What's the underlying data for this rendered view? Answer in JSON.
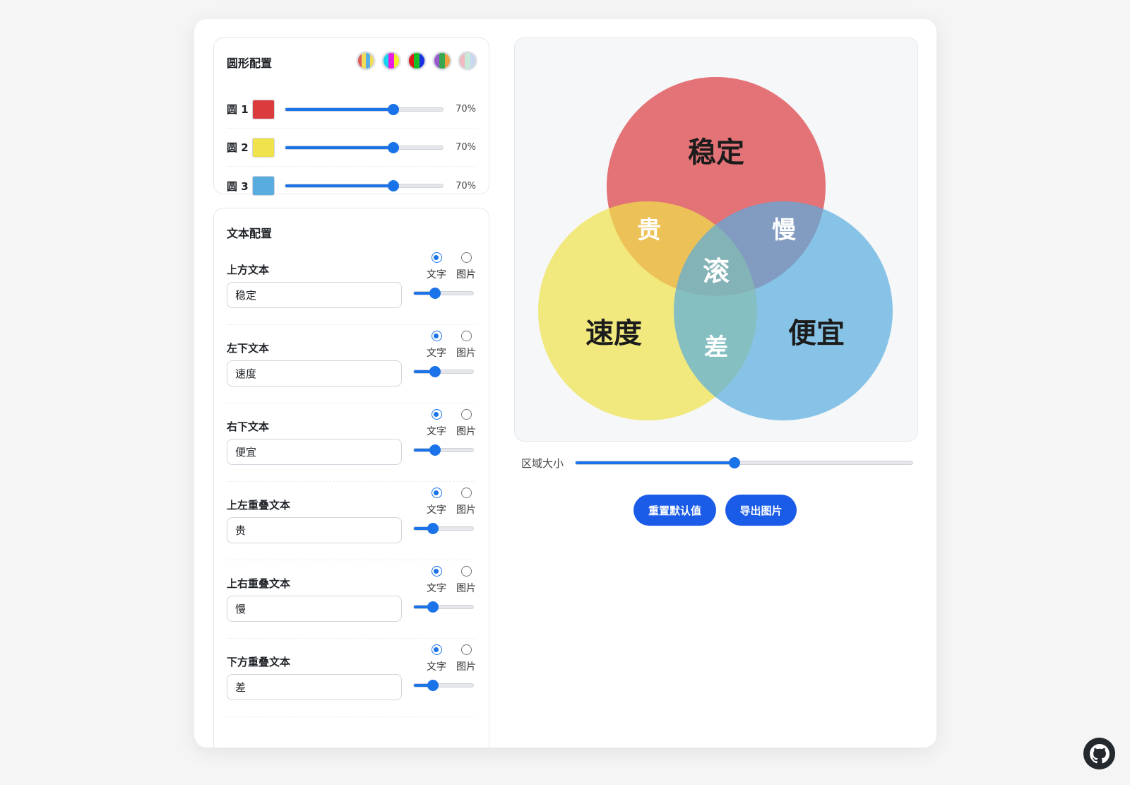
{
  "circle_panel": {
    "title": "圆形配置",
    "presets": [
      "preset-1",
      "preset-2",
      "preset-3",
      "preset-4",
      "preset-5"
    ],
    "circles": [
      {
        "label": "圆 1",
        "color": "#dc3b3e",
        "opacity": 0.7,
        "opacity_text": "70%"
      },
      {
        "label": "圆 2",
        "color": "#f0e24a",
        "opacity": 0.7,
        "opacity_text": "70%"
      },
      {
        "label": "圆 3",
        "color": "#58acdf",
        "opacity": 0.7,
        "opacity_text": "70%"
      }
    ]
  },
  "text_panel": {
    "title": "文本配置",
    "option_text": "文字",
    "option_image": "图片",
    "items": [
      {
        "label": "上方文本",
        "value": "稳定",
        "size": 0.33
      },
      {
        "label": "左下文本",
        "value": "速度",
        "size": 0.33
      },
      {
        "label": "右下文本",
        "value": "便宜",
        "size": 0.33
      },
      {
        "label": "上左重叠文本",
        "value": "贵",
        "size": 0.28
      },
      {
        "label": "上右重叠文本",
        "value": "慢",
        "size": 0.28
      },
      {
        "label": "下方重叠文本",
        "value": "差",
        "size": 0.28
      }
    ]
  },
  "venn": {
    "top": "稳定",
    "left": "速度",
    "right": "便宜",
    "top_left": "贵",
    "top_right": "慢",
    "center": "滚",
    "bottom": "差"
  },
  "area": {
    "label": "区域大小",
    "value": 0.47
  },
  "buttons": {
    "reset": "重置默认值",
    "export": "导出图片"
  }
}
